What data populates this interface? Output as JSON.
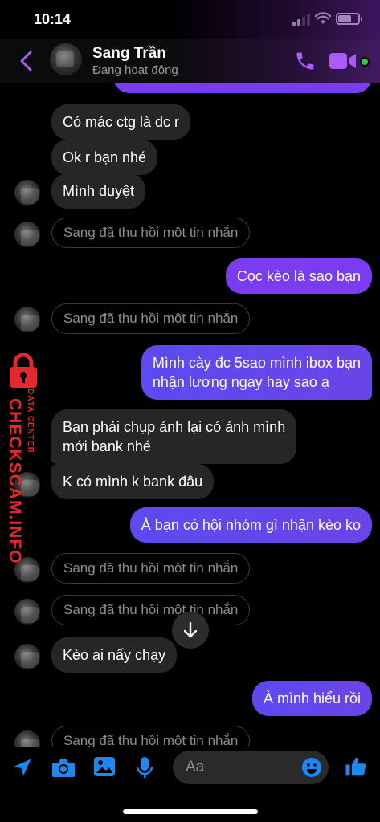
{
  "status_bar": {
    "time": "10:14"
  },
  "header": {
    "contact_name": "Sang Trần",
    "contact_status": "Đang hoạt động"
  },
  "messages": [
    {
      "type": "incoming",
      "text": "Có mác ctg là dc r"
    },
    {
      "type": "incoming",
      "text": "Ok r bạn nhé"
    },
    {
      "type": "incoming",
      "text": "Mình duyệt"
    },
    {
      "type": "recalled",
      "text": "Sang đã thu hồi một tin nhắn"
    },
    {
      "type": "outgoing",
      "text": "Cọc kèo là sao bạn"
    },
    {
      "type": "recalled",
      "text": "Sang đã thu hồi một tin nhắn"
    },
    {
      "type": "outgoing",
      "lines": [
        "Mình cày đc 5sao mình ibox bạn",
        "nhận lương ngay hay sao ạ"
      ]
    },
    {
      "type": "incoming",
      "lines": [
        "Bạn phải chụp ảnh lại có ảnh mình",
        "mới bank nhé"
      ]
    },
    {
      "type": "incoming",
      "text": "K có mình k bank đâu"
    },
    {
      "type": "outgoing",
      "text": "À bạn có hội nhóm gì nhận kèo ko"
    },
    {
      "type": "recalled",
      "text": "Sang đã thu hồi một tin nhắn"
    },
    {
      "type": "recalled",
      "text": "Sang đã thu hồi một tin nhắn"
    },
    {
      "type": "incoming",
      "text": "Kèo ai nấy chạy"
    },
    {
      "type": "outgoing",
      "text": "À mình hiểu rồi"
    },
    {
      "type": "recalled",
      "text": "Sang đã thu hồi một tin nhắn"
    }
  ],
  "watermark": {
    "main": "CHECKSCAM.INFO",
    "sub": "DATA CENTER"
  },
  "composer": {
    "placeholder": "Aa"
  },
  "icons": {
    "back": "chevron-left-icon",
    "phone": "phone-icon",
    "video": "video-camera-icon",
    "location": "location-arrow-icon",
    "camera": "camera-icon",
    "gallery": "image-icon",
    "mic": "microphone-icon",
    "emoji": "emoji-smile-icon",
    "like": "thumbs-up-icon",
    "scroll_down": "arrow-down-icon",
    "lock": "padlock-icon"
  },
  "colors": {
    "accent": "#a95cf5",
    "outgoing_bubble": "#5b4bf0",
    "incoming_bubble": "#262626",
    "composer_icon": "#1e88f2",
    "online": "#31cc46",
    "watermark": "#e8262e"
  }
}
